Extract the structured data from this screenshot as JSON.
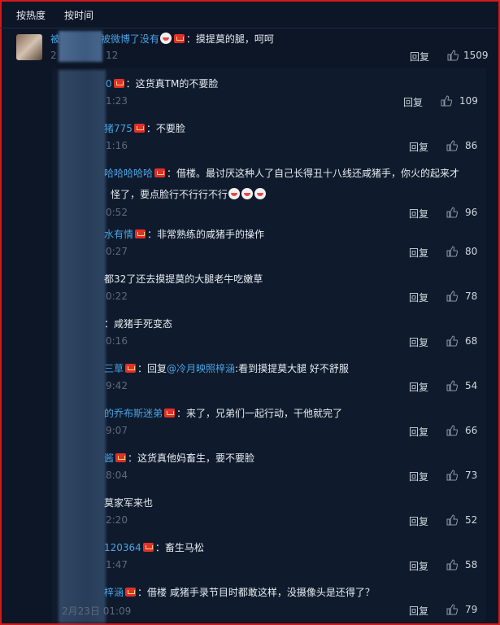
{
  "sort_tabs": {
    "hot": "按热度",
    "time": "按时间"
  },
  "top_comment": {
    "name_visible": "被",
    "name_tail": "被微博了没有",
    "text": "：摸提莫的腿，呵呵",
    "time": "2",
    "time_tail": "12",
    "reply_label": "回复",
    "likes": "1509"
  },
  "replies": [
    {
      "name": "0",
      "text": "：这货真TM的不要脸",
      "time": "1:23",
      "reply_label": "回复",
      "likes": "109"
    },
    {
      "name": "猪775",
      "text": "：不要脸",
      "time": "1:16",
      "reply_label": "回复",
      "likes": "86"
    },
    {
      "name": "哈哈哈哈哈",
      "text": "：借楼。最讨厌这种人了自己长得丑十八线还咸猪手，你火的起来才",
      "text2": "怪了，要点脸行不行行不行",
      "time": "0:52",
      "reply_label": "回复",
      "likes": "96"
    },
    {
      "name": "水有情",
      "text": "：非常熟练的咸猪手的操作",
      "time": "0:27",
      "reply_label": "回复",
      "likes": "80"
    },
    {
      "name": "",
      "text": "都32了还去摸提莫的大腿老牛吃嫩草",
      "time": "0:22",
      "reply_label": "回复",
      "likes": "78"
    },
    {
      "name": "",
      "text": "：咸猪手死变态",
      "time": "0:16",
      "reply_label": "回复",
      "likes": "68"
    },
    {
      "name": "三草",
      "text": "：回复",
      "mention": "@冷月映照梓涵",
      "text_after": ":看到摸提莫大腿 好不舒服",
      "time": "9:42",
      "reply_label": "回复",
      "likes": "54"
    },
    {
      "name": "的乔布斯迷弟",
      "text": "：来了，兄弟们一起行动，干他就完了",
      "time": "9:07",
      "reply_label": "回复",
      "likes": "66"
    },
    {
      "name": "酱",
      "text": "：这货真他妈畜生，要不要脸",
      "time": "8:04",
      "reply_label": "回复",
      "likes": "73"
    },
    {
      "name": "",
      "text": "莫家军来也",
      "time": "2:20",
      "reply_label": "回复",
      "likes": "52"
    },
    {
      "name": "120364",
      "text": "：畜生马松",
      "time": "1:47",
      "reply_label": "回复",
      "likes": "58"
    },
    {
      "name": "梓涵",
      "text": "：借楼 咸猪手录节目时都敢这样，没摄像头是还得了？",
      "time": "2月23日 01:09",
      "reply_label": "回复",
      "likes": "79"
    }
  ],
  "colors": {
    "background": "#0c1626",
    "name": "#4aa3e6",
    "frame": "#d11a1a"
  },
  "icons": {
    "like": "thumbs-up-icon",
    "badge": "red-envelope-badge-icon",
    "emoji": "laughing-emoji-icon"
  }
}
